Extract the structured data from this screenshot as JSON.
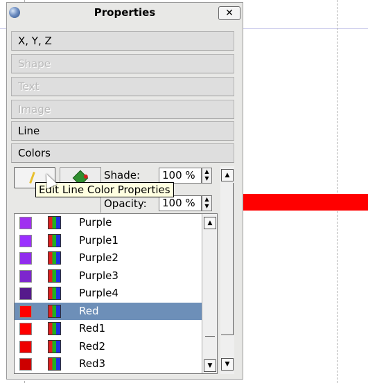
{
  "window": {
    "title": "Properties",
    "close_glyph": "✕"
  },
  "sections": [
    {
      "label": "X, Y, Z",
      "enabled": true
    },
    {
      "label": "Shape",
      "enabled": false
    },
    {
      "label": "Text",
      "enabled": false
    },
    {
      "label": "Image",
      "enabled": false
    },
    {
      "label": "Line",
      "enabled": true
    },
    {
      "label": "Colors",
      "enabled": true
    }
  ],
  "colors_panel": {
    "shade_label": "Shade:",
    "shade_value": "100 %",
    "opacity_label": "Opacity:",
    "opacity_value": "100 %",
    "tooltip": "Edit Line Color Properties",
    "colors": [
      {
        "name": "Purple",
        "hex": "#a030f0"
      },
      {
        "name": "Purple1",
        "hex": "#9b30ff"
      },
      {
        "name": "Purple2",
        "hex": "#912ced"
      },
      {
        "name": "Purple3",
        "hex": "#7d26cd"
      },
      {
        "name": "Purple4",
        "hex": "#551a8b"
      },
      {
        "name": "Red",
        "hex": "#ff0000",
        "selected": true
      },
      {
        "name": "Red1",
        "hex": "#ff0000"
      },
      {
        "name": "Red2",
        "hex": "#ee0000"
      },
      {
        "name": "Red3",
        "hex": "#cd0000"
      }
    ]
  },
  "canvas": {
    "line_color": "#ff0000",
    "guide_color": "#c4c4e8"
  }
}
